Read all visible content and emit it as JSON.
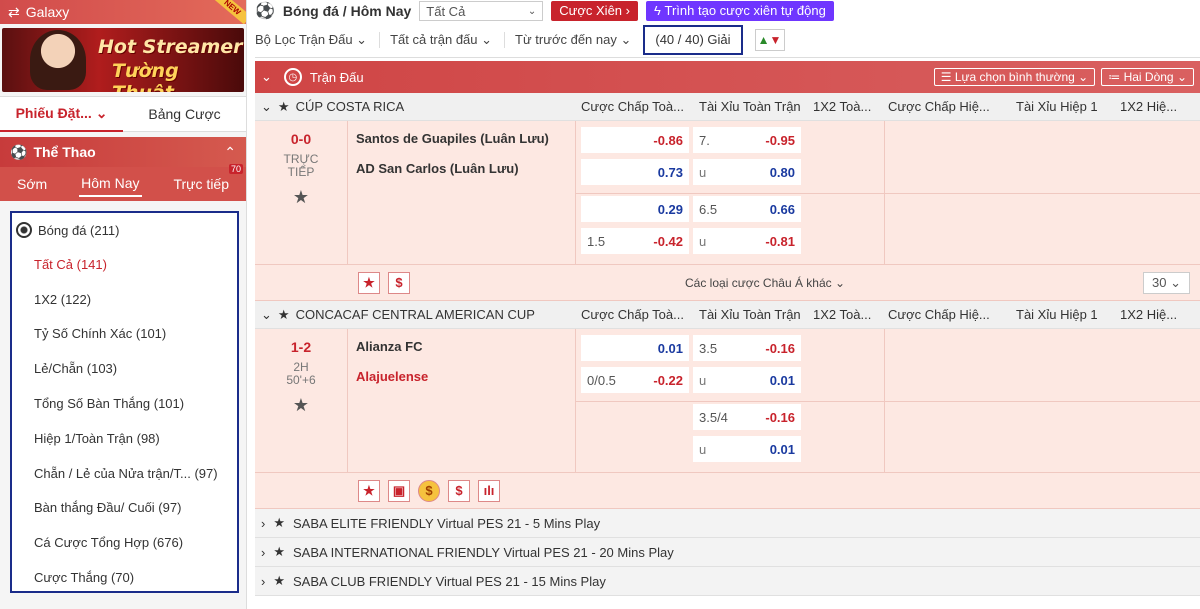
{
  "sidebar": {
    "galaxy_label": "Galaxy",
    "new_tag": "NEW",
    "banner_line1": "Hot Streamer",
    "banner_line2": "Tường Thuật",
    "tabs": [
      "Phiếu Đặt...",
      "Bảng Cược"
    ],
    "sport_header": "Thể Thao",
    "time_tabs": [
      "Sớm",
      "Hôm Nay",
      "Trực tiếp"
    ],
    "live_badge": "70",
    "sport": "Bóng đá  (211)",
    "items": [
      "Tất Cả (141)",
      "1X2 (122)",
      "Tỷ Số Chính Xác (101)",
      "Lẻ/Chẵn (103)",
      "Tổng Số Bàn Thắng (101)",
      "Hiệp 1/Toàn Trận (98)",
      "Chẵn / Lẻ của Nửa trận/T...  (97)",
      "Bàn thắng Đầu/ Cuối (97)",
      "Cá Cược Tổng Hợp (676)",
      "Cược Thắng (70)"
    ]
  },
  "topbar": {
    "title": "Bóng đá / Hôm Nay",
    "select": "Tất Cả",
    "btn1": "Cược Xiên",
    "btn2": "Trình tạo cược xiên tự động"
  },
  "filters": {
    "f1": "Bộ Lọc Trận Đấu",
    "f2": "Tất cả trận đấu",
    "f3": "Từ trước đến nay",
    "count": "(40 / 40) Giải"
  },
  "header": {
    "label": "Trận Đấu",
    "view": "Lựa chọn bình thường",
    "rows": "Hai Dòng"
  },
  "columns": [
    "Cược Chấp Toà...",
    "Tài Xỉu Toàn Trận",
    "1X2 Toà...",
    "Cược Chấp Hiệ...",
    "Tài Xỉu Hiệp 1",
    "1X2 Hiệ..."
  ],
  "leagues": {
    "l1": "CÚP COSTA RICA",
    "l2": "CONCACAF CENTRAL AMERICAN CUP"
  },
  "match1": {
    "score": "0-0",
    "status": "TRỰC TIẾP",
    "home": "Santos de Guapiles (Luân Lưu)",
    "away": "AD San Carlos (Luân Lưu)",
    "r1": {
      "h": "",
      "hv": "-0.86",
      "t": "7.",
      "tv": "-0.95"
    },
    "r2": {
      "h": "",
      "hv": "0.73",
      "t": "u",
      "tv": "0.80"
    },
    "r3": {
      "h": "",
      "hv": "0.29",
      "t": "6.5",
      "tv": "0.66"
    },
    "r4": {
      "h": "1.5",
      "hv": "-0.42",
      "t": "u",
      "tv": "-0.81"
    },
    "more": "Các loại cược Châu Á khác",
    "page": "30"
  },
  "match2": {
    "score": "1-2",
    "status1": "2H",
    "status2": "50'+6",
    "home": "Alianza FC",
    "away": "Alajuelense",
    "r1": {
      "h": "",
      "hv": "0.01",
      "t": "3.5",
      "tv": "-0.16"
    },
    "r2": {
      "h": "0/0.5",
      "hv": "-0.22",
      "t": "u",
      "tv": "0.01"
    },
    "r3": {
      "t": "3.5/4",
      "tv": "-0.16"
    },
    "r4": {
      "t": "u",
      "tv": "0.01"
    }
  },
  "virtual": [
    "SABA ELITE FRIENDLY Virtual PES 21 - 5 Mins Play",
    "SABA INTERNATIONAL FRIENDLY Virtual PES 21 - 20 Mins Play",
    "SABA CLUB FRIENDLY Virtual PES 21 - 15 Mins Play"
  ]
}
